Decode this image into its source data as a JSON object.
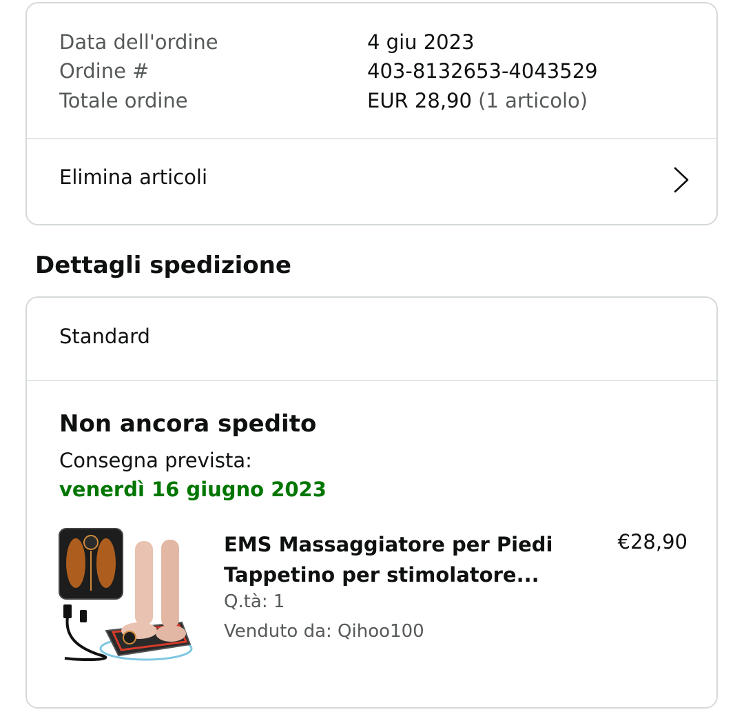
{
  "order_summary": {
    "rows": [
      {
        "label": "Data dell'ordine",
        "value": "4 giu 2023",
        "extra": ""
      },
      {
        "label": "Ordine #",
        "value": "403-8132653-4043529",
        "extra": ""
      },
      {
        "label": "Totale ordine",
        "value": "EUR 28,90",
        "extra": "(1 articolo)"
      }
    ],
    "remove_items_label": "Elimina articoli",
    "chevron_icon": "chevron-right-icon"
  },
  "shipping": {
    "section_title": "Dettagli spedizione",
    "method": "Standard",
    "status": "Non ancora spedito",
    "eta_label": "Consegna prevista:",
    "eta_date": "venerdì 16 giugno 2023",
    "eta_color": "#007600"
  },
  "item": {
    "title_line1": "EMS Massaggiatore per Piedi",
    "title_line2": "Tappetino per stimolatore...",
    "price": "€28,90",
    "qty": "Q.tà: 1",
    "seller": "Venduto da: Qihoo100",
    "image_icon": "product-image"
  }
}
